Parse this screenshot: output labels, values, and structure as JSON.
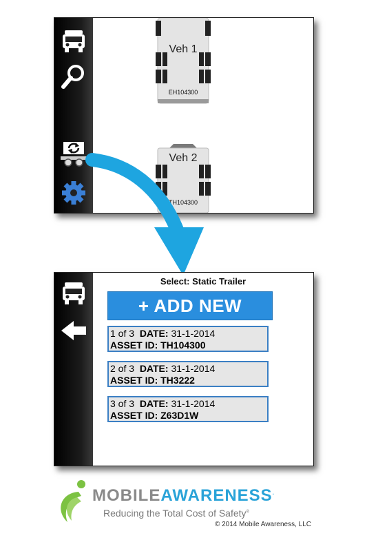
{
  "top_screen": {
    "vehicles": [
      {
        "label": "Veh 1",
        "asset_id": "EH104300"
      },
      {
        "label": "Veh 2",
        "asset_id": "TH104300"
      }
    ],
    "sidebar_icons": [
      "truck-icon",
      "search-icon",
      "swap-trailer-icon",
      "gear-icon"
    ]
  },
  "bottom_screen": {
    "title": "Select: Static Trailer",
    "add_button": "+ ADD NEW",
    "records": [
      {
        "index": "1 of 3",
        "date_label": "DATE:",
        "date": "31-1-2014",
        "asset_label": "ASSET ID:",
        "asset_id": "TH104300"
      },
      {
        "index": "2 of 3",
        "date_label": "DATE:",
        "date": "31-1-2014",
        "asset_label": "ASSET ID:",
        "asset_id": "TH3222"
      },
      {
        "index": "3 of 3",
        "date_label": "DATE:",
        "date": "31-1-2014",
        "asset_label": "ASSET ID:",
        "asset_id": "Z63D1W"
      }
    ],
    "sidebar_icons": [
      "truck-icon",
      "back-arrow-icon"
    ]
  },
  "branding": {
    "brand_mobile": "MOBILE",
    "brand_awareness": "AWARENESS",
    "brand_mark": ".",
    "tagline": "Reducing the Total Cost of Safety",
    "tagline_mark": "®",
    "copyright": "© 2014 Mobile Awareness, LLC"
  },
  "colors": {
    "accent_blue": "#2a8ede",
    "arrow_blue": "#1ea5e0",
    "gear_blue": "#3a7fd5",
    "logo_green": "#7cc242"
  }
}
